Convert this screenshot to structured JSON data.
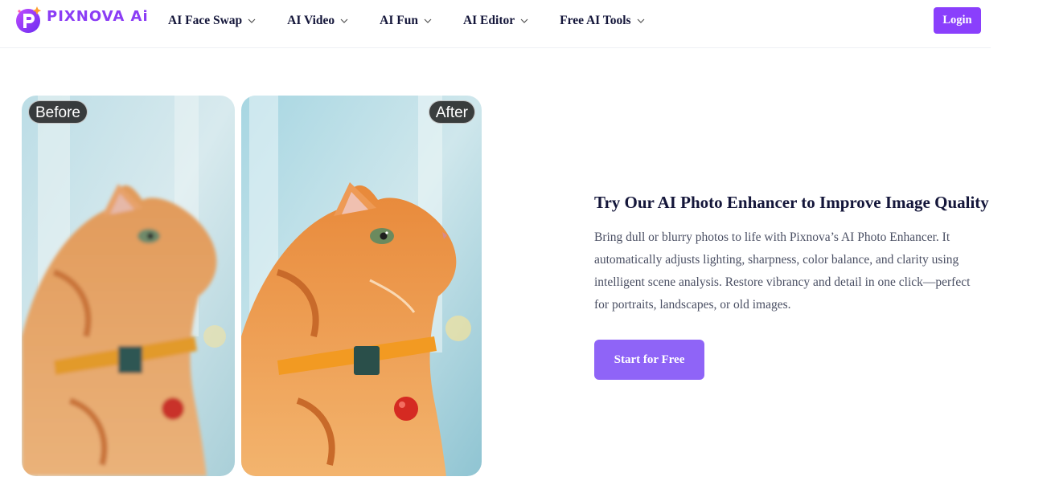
{
  "header": {
    "logo_text": "PIXNOVA Ai",
    "nav": [
      {
        "label": "AI Face Swap"
      },
      {
        "label": "AI Video"
      },
      {
        "label": "AI Fun"
      },
      {
        "label": "AI Editor"
      },
      {
        "label": "Free AI Tools"
      }
    ],
    "login_label": "Login"
  },
  "comparison": {
    "before_label": "Before",
    "after_label": "After"
  },
  "feature": {
    "title": "Try Our AI Photo Enhancer to Improve Image Quality",
    "description": "Bring dull or blurry photos to life with Pixnova’s AI Photo Enhancer. It automatically adjusts lighting, sharpness, color balance, and clarity using intelligent scene analysis. Restore vibrancy and detail in one click—perfect for portraits, landscapes, or old images.",
    "cta_label": "Start for Free"
  },
  "colors": {
    "brand": "#8a3ffc",
    "cta": "#8f64f7",
    "heading": "#14163a",
    "body_text": "#4a4f63"
  }
}
